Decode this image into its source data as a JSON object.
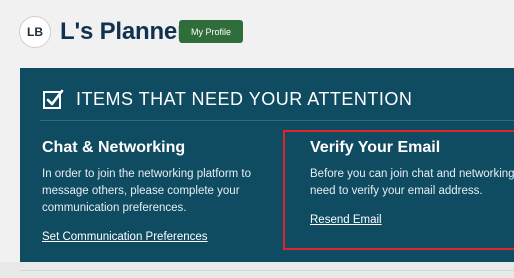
{
  "header": {
    "avatar_initials": "LB",
    "title": "L's Planner",
    "profile_button": "My Profile"
  },
  "attention": {
    "heading": "ITEMS THAT NEED YOUR ATTENTION",
    "icon": "checkbox-checked-icon",
    "items": [
      {
        "title": "Chat & Networking",
        "description": "In order to join the networking platform to message others, please complete your communication preferences.",
        "link": "Set Communication Preferences"
      },
      {
        "title": "Verify Your Email",
        "description": "Before you can join chat and networking you'll need to verify your email address.",
        "link": "Resend Email"
      }
    ]
  },
  "colors": {
    "panel_bg": "#0f4c62",
    "profile_button_bg": "#2f6e3a",
    "title_color": "#12314f",
    "highlight_border": "#e0252a"
  }
}
